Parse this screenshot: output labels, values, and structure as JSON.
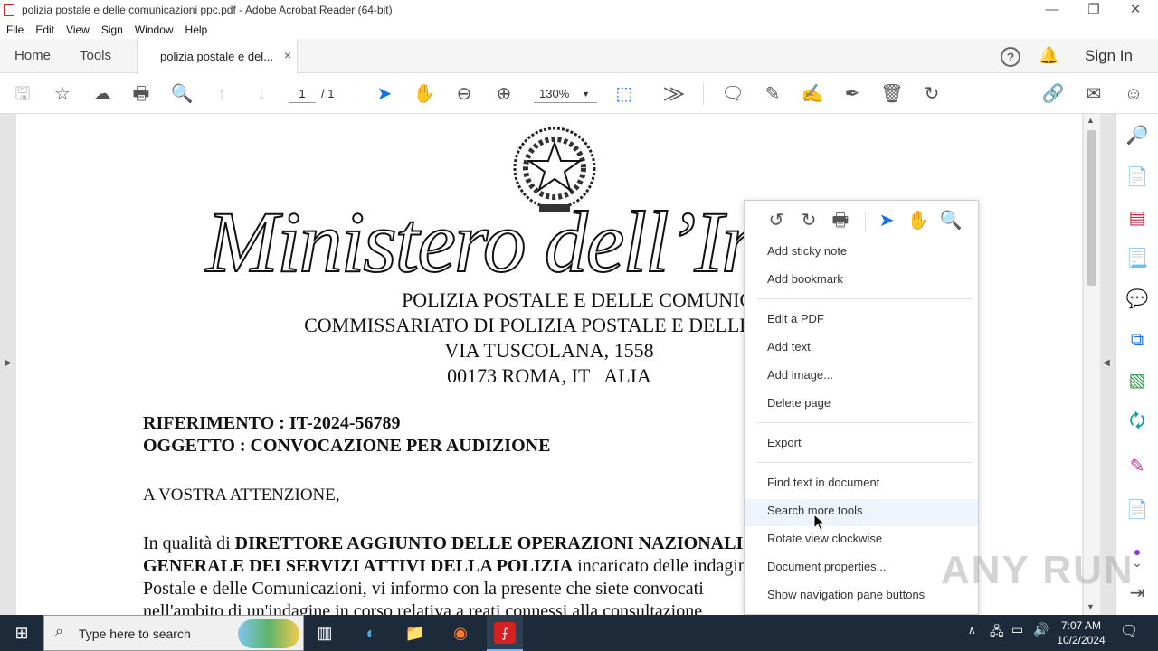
{
  "window": {
    "title": "polizia postale e delle comunicazioni ppc.pdf - Adobe Acrobat Reader (64-bit)",
    "minimize": "—",
    "maximize": "❐",
    "close": "✕"
  },
  "menu": [
    "File",
    "Edit",
    "View",
    "Sign",
    "Window",
    "Help"
  ],
  "tabs": {
    "home": "Home",
    "tools": "Tools",
    "doc": "polizia postale e del...",
    "close": "×"
  },
  "header_right": {
    "sign_in": "Sign In",
    "help_icon": "help-icon",
    "bell_icon": "notification-bell-icon"
  },
  "toolbar": {
    "page_current": "1",
    "page_total": "/ 1",
    "zoom": "130%"
  },
  "document": {
    "logo_script": "Ministero dell’Interno",
    "header_lines": [
      "POLIZIA POSTALE E DELLE COMUNICAZIONI",
      "COMMISSARIATO DI POLIZIA POSTALE E DELLE COMUNICAZIONI",
      "VIA TUSCOLANA, 1558",
      "00173 ROMA, IT   ALIA"
    ],
    "riferimento": "RIFERIMENTO : IT-2024-56789",
    "oggetto": "OGGETTO : CONVOCAZIONE PER AUDIZIONE",
    "attenzione": "A VOSTRA ATTENZIONE,",
    "body1_normal": "In qualità di ",
    "body1_bold": "DIRETTORE AGGIUNTO DELLE OPERAZIONI NAZIONALI",
    "body2_bold": "GENERALE DEI SERVIZI ATTIVI DELLA POLIZIA",
    "body2_normal": " incaricato delle indagini",
    "body3": "Postale e delle Comunicazioni, vi informo con la presente che siete convocati",
    "body4": "nell'ambito di un'indagine in corso relativa a reati connessi alla consultazione"
  },
  "context_menu": {
    "items": [
      "Add sticky note",
      "Add bookmark",
      "Edit a PDF",
      "Add text",
      "Add image...",
      "Delete page",
      "Export",
      "Find text in document",
      "Search more tools",
      "Rotate view clockwise",
      "Document properties...",
      "Show navigation pane buttons"
    ]
  },
  "watermark": "ANY RUN",
  "taskbar": {
    "search_placeholder": "Type here to search",
    "time": "7:07 AM",
    "date": "10/2/2024"
  }
}
